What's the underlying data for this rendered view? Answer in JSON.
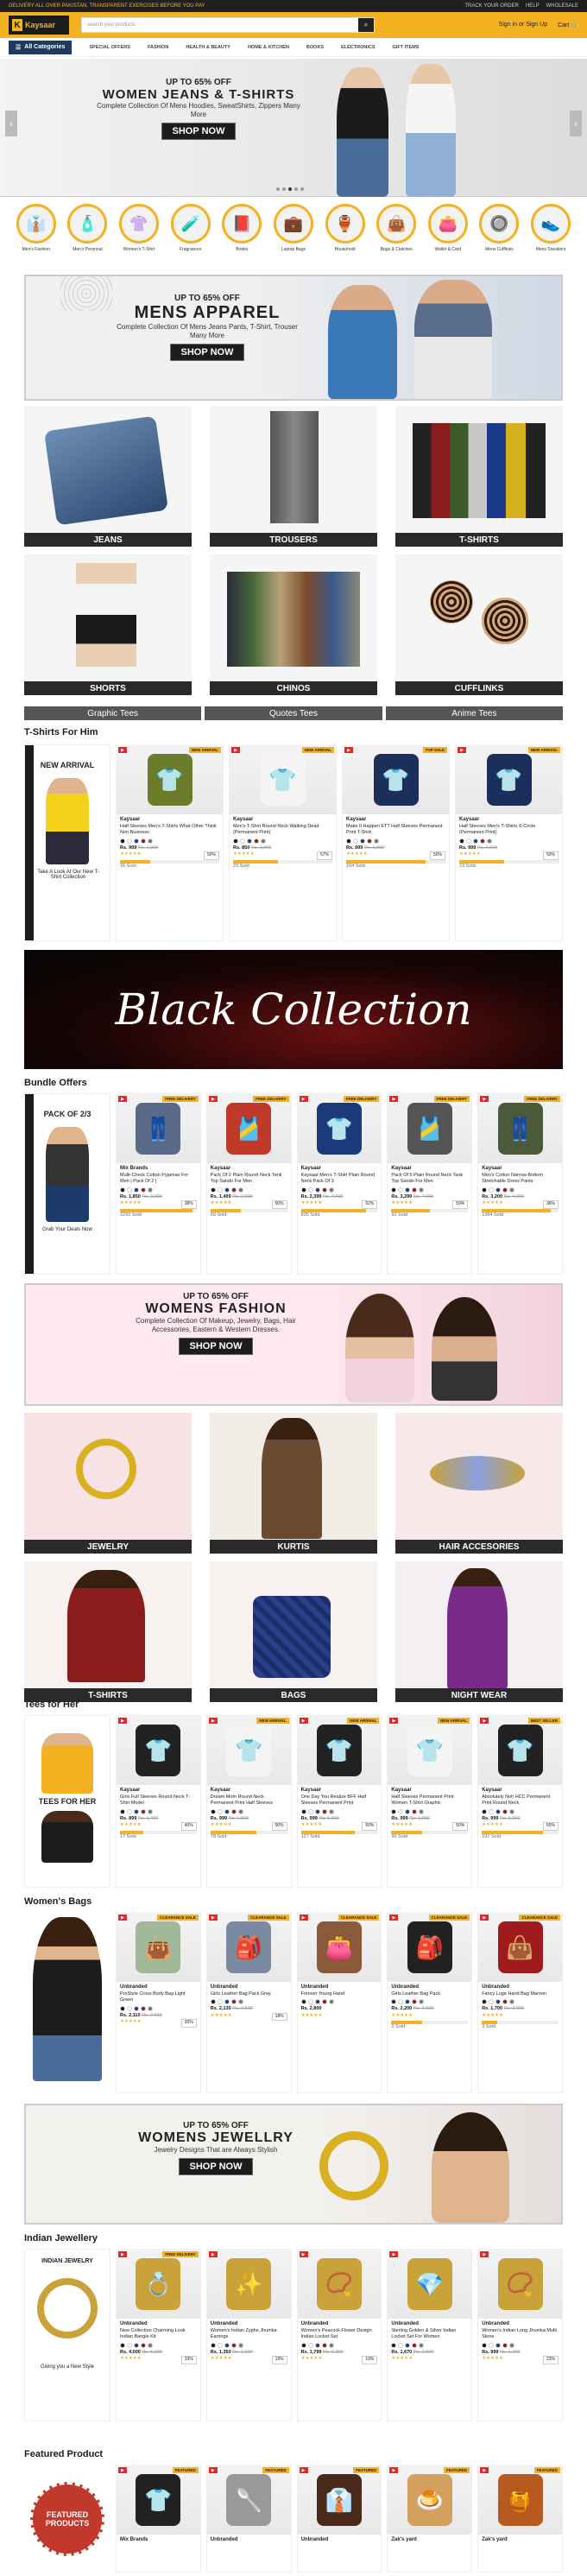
{
  "topbar": {
    "left": "DELIVERY ALL OVER PAKISTAN, TRANSPARENT EXERCISES BEFORE YOU PAY",
    "right": [
      "TRACK YOUR ORDER",
      "HELP",
      "WHOLESALE"
    ]
  },
  "header": {
    "logo": "Kaysaar",
    "search_placeholder": "search your products",
    "signin": "Sign in or Sign Up",
    "cart": "Cart"
  },
  "nav": {
    "all": "All Categories",
    "items": [
      "SPECIAL OFFERS",
      "FASHION",
      "HEALTH & BEAUTY",
      "HOME & KITCHEN",
      "BOOKS",
      "ELECTRONICS",
      "GIFT ITEMS"
    ]
  },
  "hero1": {
    "off": "UP TO 65% OFF",
    "title": "WOMEN JEANS & T-SHIRTS",
    "sub": "Complete Collection Of Mens Hoodies, SweatShirts, Zippers Many More",
    "btn": "SHOP NOW"
  },
  "categories": [
    {
      "label": "Men's Fashion",
      "icon": "👔"
    },
    {
      "label": "Men's Personal",
      "icon": "🧴"
    },
    {
      "label": "Women's T-Shirt",
      "icon": "👚"
    },
    {
      "label": "Fragrances",
      "icon": "🧪"
    },
    {
      "label": "Books",
      "icon": "📕"
    },
    {
      "label": "Laptop Bags",
      "icon": "💼"
    },
    {
      "label": "Household",
      "icon": "🏺"
    },
    {
      "label": "Bags & Clutches",
      "icon": "👜"
    },
    {
      "label": "Wallet & Card",
      "icon": "👛"
    },
    {
      "label": "Mens Cufflinks",
      "icon": "🔘"
    },
    {
      "label": "Mens Sneakers",
      "icon": "👟"
    }
  ],
  "hero2": {
    "off": "UP TO 65% OFF",
    "title": "MENS APPAREL",
    "sub": "Complete Collection Of Mens Jeans Pants, T-Shirt, Trouser Many More",
    "btn": "SHOP NOW"
  },
  "mens_tiles": [
    "JEANS",
    "TROUSERS",
    "T-SHIRTS",
    "SHORTS",
    "CHINOS",
    "CUFFLINKS"
  ],
  "stripes": [
    "Graphic Tees",
    "Quotes Tees",
    "Anime Tees"
  ],
  "tshirts": {
    "title": "T-Shirts For Him",
    "side_new": "NEW ARRIVAL",
    "side_text": "Take A Look At Our New T-Shirt Collection",
    "products": [
      {
        "brand": "Kaysaar",
        "name": "Half Sleeves Men's T-Shirts What Other Think Non Business",
        "price": "Rs. 999",
        "old": "Rs. 1,999",
        "disc": "50%",
        "sold": "16 Sold",
        "fill": 30,
        "tag": "NEW ARRIVAL",
        "icon": "👕",
        "color": "#6b7d2a"
      },
      {
        "brand": "Kaysaar",
        "name": "Men's T-Shirt Round Neck Walking Dead (Permanent Print)",
        "price": "Rs. 850",
        "old": "Rs. 1,999",
        "disc": "57%",
        "sold": "23 Sold",
        "fill": 45,
        "tag": "NEW ARRIVAL",
        "icon": "👕",
        "color": "#f4f4f4"
      },
      {
        "brand": "Kaysaar",
        "name": "Make It Happen ETT Half Sleeves Permanent Print T-Shirt",
        "price": "Rs. 999",
        "old": "Rs. 1,999",
        "disc": "50%",
        "sold": "164 Sold",
        "fill": 80,
        "tag": "TOP SALE",
        "icon": "👕",
        "color": "#1c2e5a"
      },
      {
        "brand": "Kaysaar",
        "name": "Half Sleeves Men's T-Shirts X-Circle (Permanent Print)",
        "price": "Rs. 999",
        "old": "Rs. 1,999",
        "disc": "50%",
        "sold": "23 Sold",
        "fill": 45,
        "tag": "NEW ARRIVAL",
        "icon": "👕",
        "color": "#1c2e5a"
      }
    ]
  },
  "black_collection": "Black Collection",
  "bundles": {
    "title": "Bundle Offers",
    "side_pack": "PACK OF 2/3",
    "side_text": "Grab Your Deals Now",
    "products": [
      {
        "brand": "Mix Brands",
        "name": "Multi-Check Cotton Pyjamas For Men | Pack Of 2 |",
        "price": "Rs. 1,850",
        "old": "Rs. 2,999",
        "disc": "38%",
        "sold": "2293 Sold",
        "fill": 95,
        "tag": "FREE DELIVERY",
        "icon": "👖",
        "color": "#5a6a8a"
      },
      {
        "brand": "Kaysaar",
        "name": "Pack Of 2 Plain Round Neck Tank Top Sando For Men",
        "price": "Rs. 1,499",
        "old": "Rs. 2,999",
        "disc": "50%",
        "sold": "69 Sold",
        "fill": 40,
        "tag": "FREE DELIVERY",
        "icon": "🎽",
        "color": "#c0392b"
      },
      {
        "brand": "Kaysaar",
        "name": "Kaysaar Men's T-Shirt Plain Round Neck Pack Of 3",
        "price": "Rs. 2,399",
        "old": "Rs. 4,999",
        "disc": "52%",
        "sold": "835 Sold",
        "fill": 85,
        "tag": "FREE DELIVERY",
        "icon": "👕",
        "color": "#1c3a7a"
      },
      {
        "brand": "Kaysaar",
        "name": "Pack Of 5 Plain Round Neck Tank Top Sando For Men",
        "price": "Rs. 3,299",
        "old": "Rs. 7,999",
        "disc": "59%",
        "sold": "92 Sold",
        "fill": 50,
        "tag": "FREE DELIVERY",
        "icon": "🎽",
        "color": "#555"
      },
      {
        "brand": "Kaysaar",
        "name": "Men's Cotton Narrow-Bottom Stretchable Dress Pants",
        "price": "Rs. 3,200",
        "old": "Rs. 4,999",
        "disc": "36%",
        "sold": "1384 Sold",
        "fill": 90,
        "tag": "FREE DELIVERY",
        "icon": "👖",
        "color": "#4a5a3a"
      }
    ]
  },
  "hero3": {
    "off": "UP TO 65% OFF",
    "title": "WOMENS FASHION",
    "sub": "Complete Collection Of Makeup, Jewelry, Bags, Hair Accessories, Eastern & Western Dresses.",
    "btn": "SHOP NOW"
  },
  "womens_tiles": [
    "JEWELRY",
    "KURTIS",
    "HAIR ACCESORIES",
    "T-SHIRTS",
    "BAGS",
    "NIGHT WEAR"
  ],
  "tees_her": {
    "title": "Tees for Her",
    "side_title": "TEES FOR HER",
    "products": [
      {
        "brand": "Kaysaar",
        "name": "Girls Full Sleeves Round Neck T-Shirt Model",
        "price": "Rs. 899",
        "old": "Rs. 1,499",
        "disc": "40%",
        "sold": "17 Sold",
        "fill": 30,
        "tag": "",
        "icon": "👕",
        "color": "#222"
      },
      {
        "brand": "Kaysaar",
        "name": "Dream Mom Round Neck Permanent Print Half Sleeves",
        "price": "Rs. 999",
        "old": "Rs. 1,999",
        "disc": "50%",
        "sold": "78 Sold",
        "fill": 60,
        "tag": "NEW ARRIVAL",
        "icon": "👕",
        "color": "#f4f4f4"
      },
      {
        "brand": "Kaysaar",
        "name": "One Day You Realize BFF Half Sleeves Permanent Print",
        "price": "Rs. 999",
        "old": "Rs. 1,999",
        "disc": "50%",
        "sold": "127 Sold",
        "fill": 70,
        "tag": "NEW ARRIVAL",
        "icon": "👕",
        "color": "#222"
      },
      {
        "brand": "Kaysaar",
        "name": "Half Sleeves Permanent Print Women T-Shirt Graphic",
        "price": "Rs. 999",
        "old": "Rs. 1,999",
        "disc": "50%",
        "sold": "36 Sold",
        "fill": 40,
        "tag": "NEW ARRIVAL",
        "icon": "👕",
        "color": "#f4f4f4"
      },
      {
        "brand": "Kaysaar",
        "name": "Absolutely Not! HCC Permanent Print Round Neck",
        "price": "Rs. 999",
        "old": "Rs. 1,999",
        "disc": "50%",
        "sold": "197 Sold",
        "fill": 80,
        "tag": "BEST SELLER",
        "icon": "👕",
        "color": "#222"
      }
    ]
  },
  "bags": {
    "title": "Women's Bags",
    "products": [
      {
        "brand": "Unbranded",
        "name": "ProStyle Cross Body Bag Light Green",
        "price": "Rs. 2,110",
        "old": "Rs. 2,999",
        "disc": "30%",
        "sold": "",
        "fill": 0,
        "tag": "CLEARANCE SALE",
        "icon": "👜",
        "color": "#9fb89a"
      },
      {
        "brand": "Unbranded",
        "name": "Girls Leather Bag Pack Grey",
        "price": "Rs. 2,130",
        "old": "Rs. 2,599",
        "disc": "18%",
        "sold": "",
        "fill": 0,
        "tag": "CLEARANCE SALE",
        "icon": "🎒",
        "color": "#7a8aa0"
      },
      {
        "brand": "Unbranded",
        "name": "Forever Young Hand",
        "price": "Rs. 2,800",
        "old": "",
        "disc": "",
        "sold": "",
        "fill": 0,
        "tag": "CLEARANCE SALE",
        "icon": "👛",
        "color": "#8a5a3a"
      },
      {
        "brand": "Unbranded",
        "name": "Girls Leather Bag Pack",
        "price": "Rs. 2,200",
        "old": "Rs. 2,999",
        "disc": "",
        "sold": "2 Sold",
        "fill": 40,
        "tag": "CLEARANCE SALE",
        "icon": "🎒",
        "color": "#222"
      },
      {
        "brand": "Unbranded",
        "name": "Fancy Luge Hand Bag Maroon",
        "price": "Rs. 1,700",
        "old": "Rs. 2,999",
        "disc": "",
        "sold": "3 Sold",
        "fill": 20,
        "tag": "CLEARANCE SALE",
        "icon": "👜",
        "color": "#a01c1c"
      }
    ]
  },
  "hero4": {
    "off": "UP TO 65% OFF",
    "title": "WOMENS JEWELLRY",
    "sub": "Jewelry Designs That are Always Stylish",
    "btn": "SHOP NOW"
  },
  "jewellery": {
    "title": "Indian Jewellery",
    "side_title": "INDIAN JEWELRY",
    "side_text": "Giving you a New Style",
    "products": [
      {
        "brand": "Unbranded",
        "name": "New Collection Charming Look Indian Bangle Kit",
        "price": "Rs. 4,000",
        "old": "Rs. 5,999",
        "disc": "33%",
        "sold": "",
        "fill": 0,
        "tag": "FREE DELIVERY",
        "icon": "💍",
        "color": "#c9a23a"
      },
      {
        "brand": "Unbranded",
        "name": "Women's Indian Zyphe Jhumka Earrings",
        "price": "Rs. 1,350",
        "old": "Rs. 1,699",
        "disc": "19%",
        "sold": "",
        "fill": 0,
        "tag": "",
        "icon": "✨",
        "color": "#c9a23a"
      },
      {
        "brand": "Unbranded",
        "name": "Women's Peacock Flower Design Indian Locket Set",
        "price": "Rs. 1,799",
        "old": "Rs. 2,299",
        "disc": "19%",
        "sold": "",
        "fill": 0,
        "tag": "",
        "icon": "📿",
        "color": "#c9a23a"
      },
      {
        "brand": "Unbranded",
        "name": "Sterling Golden & Silver Indian Locket Set For Women",
        "price": "Rs. 1,670",
        "old": "Rs. 2,999",
        "disc": "",
        "sold": "",
        "fill": 0,
        "tag": "",
        "icon": "💎",
        "color": "#c9a23a"
      },
      {
        "brand": "Unbranded",
        "name": "Women's Indian Long Jhumka Multi Stone",
        "price": "Rs. 999",
        "old": "Rs. 1,299",
        "disc": "23%",
        "sold": "",
        "fill": 0,
        "tag": "",
        "icon": "📿",
        "color": "#c9a23a"
      }
    ]
  },
  "featured": {
    "title": "Featured Product",
    "side_badge": "FEATURED PRODUCTS",
    "products": [
      {
        "brand": "Mix Brands",
        "tag": "FEATURED",
        "icon": "👕",
        "color": "#222"
      },
      {
        "brand": "Unbranded",
        "tag": "FEATURED",
        "icon": "🥄",
        "color": "#999"
      },
      {
        "brand": "Unbranded",
        "tag": "FEATURED",
        "icon": "👔",
        "color": "#4a2a1a"
      },
      {
        "brand": "Zak's yard",
        "tag": "FEATURED",
        "icon": "🍮",
        "color": "#d4a060"
      },
      {
        "brand": "Zak's yard",
        "tag": "FEATURED",
        "icon": "🍯",
        "color": "#b85a20"
      }
    ]
  }
}
